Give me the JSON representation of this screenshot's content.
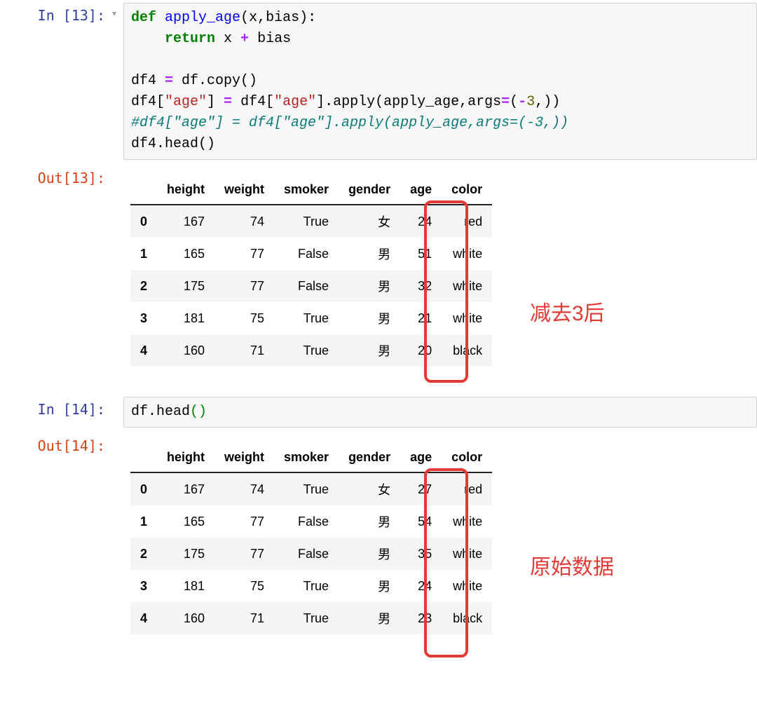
{
  "cells": {
    "in13": {
      "prompt": "In [13]:",
      "code": {
        "l1": {
          "def": "def",
          "fn": "apply_age",
          "rest1": "(x,bias)",
          "colon": ":"
        },
        "l2": {
          "ret": "return",
          "rest": " x ",
          "plus": "+",
          "rest2": " bias"
        },
        "l4": {
          "a": "df4 ",
          "eq": "=",
          "b": " df.copy()"
        },
        "l5": {
          "a": "df4[",
          "s1": "\"age\"",
          "b": "] ",
          "eq": "=",
          "c": " df4[",
          "s2": "\"age\"",
          "d": "].apply(apply_age,args",
          "eq2": "=",
          "e": "(",
          "op": "-",
          "n": "3",
          "f": ",))"
        },
        "l6": {
          "c": "#df4[\"age\"] = df4[\"age\"].apply(apply_age,args=(-3,))"
        },
        "l7": {
          "a": "df4.head()"
        }
      }
    },
    "out13": {
      "prompt": "Out[13]:",
      "headers": [
        "",
        "height",
        "weight",
        "smoker",
        "gender",
        "age",
        "color"
      ],
      "rows": [
        {
          "idx": "0",
          "height": "167",
          "weight": "74",
          "smoker": "True",
          "gender": "女",
          "age": "24",
          "color": "red"
        },
        {
          "idx": "1",
          "height": "165",
          "weight": "77",
          "smoker": "False",
          "gender": "男",
          "age": "51",
          "color": "white"
        },
        {
          "idx": "2",
          "height": "175",
          "weight": "77",
          "smoker": "False",
          "gender": "男",
          "age": "32",
          "color": "white"
        },
        {
          "idx": "3",
          "height": "181",
          "weight": "75",
          "smoker": "True",
          "gender": "男",
          "age": "21",
          "color": "white"
        },
        {
          "idx": "4",
          "height": "160",
          "weight": "71",
          "smoker": "True",
          "gender": "男",
          "age": "20",
          "color": "black"
        }
      ],
      "annotation": "减去3后"
    },
    "in14": {
      "prompt": "In [14]:",
      "code": {
        "a": "df.head",
        "p1": "(",
        "p2": ")"
      }
    },
    "out14": {
      "prompt": "Out[14]:",
      "headers": [
        "",
        "height",
        "weight",
        "smoker",
        "gender",
        "age",
        "color"
      ],
      "rows": [
        {
          "idx": "0",
          "height": "167",
          "weight": "74",
          "smoker": "True",
          "gender": "女",
          "age": "27",
          "color": "red"
        },
        {
          "idx": "1",
          "height": "165",
          "weight": "77",
          "smoker": "False",
          "gender": "男",
          "age": "54",
          "color": "white"
        },
        {
          "idx": "2",
          "height": "175",
          "weight": "77",
          "smoker": "False",
          "gender": "男",
          "age": "35",
          "color": "white"
        },
        {
          "idx": "3",
          "height": "181",
          "weight": "75",
          "smoker": "True",
          "gender": "男",
          "age": "24",
          "color": "white"
        },
        {
          "idx": "4",
          "height": "160",
          "weight": "71",
          "smoker": "True",
          "gender": "男",
          "age": "23",
          "color": "black"
        }
      ],
      "annotation": "原始数据"
    }
  }
}
